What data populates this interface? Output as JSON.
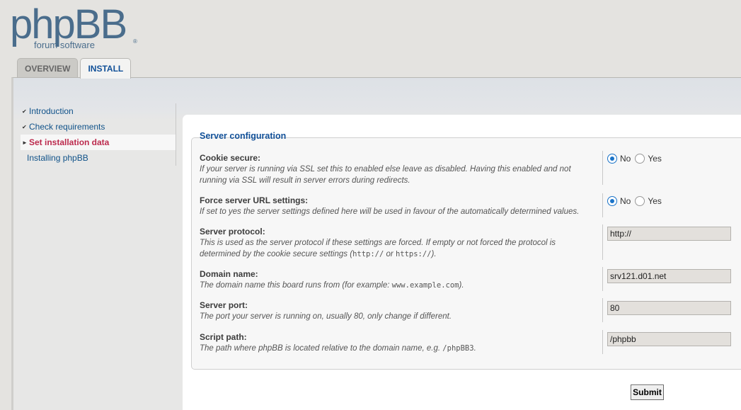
{
  "logo": {
    "main": "phpBB",
    "sub": "forum software",
    "reg": "®"
  },
  "tabs": [
    {
      "label": "OVERVIEW",
      "active": false
    },
    {
      "label": "INSTALL",
      "active": true
    }
  ],
  "menu": {
    "items": [
      {
        "label": "Introduction",
        "marker": "✔"
      },
      {
        "label": "Check requirements",
        "marker": "✔"
      },
      {
        "label": "Set installation data",
        "marker": "►",
        "active": true
      },
      {
        "label": "Installing phpBB"
      }
    ]
  },
  "form": {
    "legend": "Server configuration",
    "cookie_secure": {
      "label": "Cookie secure:",
      "explain": "If your server is running via SSL set this to enabled else leave as disabled. Having this enabled and not running via SSL will result in server errors during redirects.",
      "no": "No",
      "yes": "Yes",
      "value": "No"
    },
    "force_server": {
      "label": "Force server URL settings:",
      "explain": "If set to yes the server settings defined here will be used in favour of the automatically determined values.",
      "no": "No",
      "yes": "Yes",
      "value": "No"
    },
    "server_protocol": {
      "label": "Server protocol:",
      "explain_a": "This is used as the server protocol if these settings are forced. If empty or not forced the protocol is determined by the cookie secure settings (",
      "code1": "http://",
      "explain_b": " or ",
      "code2": "https://",
      "explain_c": ").",
      "value": "http://"
    },
    "domain_name": {
      "label": "Domain name:",
      "explain_a": "The domain name this board runs from (for example: ",
      "code": "www.example.com",
      "explain_b": ").",
      "value": "srv121.d01.net"
    },
    "server_port": {
      "label": "Server port:",
      "explain": "The port your server is running on, usually 80, only change if different.",
      "value": "80"
    },
    "script_path": {
      "label": "Script path:",
      "explain_a": "The path where phpBB is located relative to the domain name, e.g. ",
      "code": "/phpBB3",
      "explain_b": ".",
      "value": "/phpbb"
    },
    "submit_label": "Submit"
  },
  "colors": {
    "accent": "#115098",
    "active_menu": "#bc2a4d",
    "radio": "#1a73c8"
  }
}
